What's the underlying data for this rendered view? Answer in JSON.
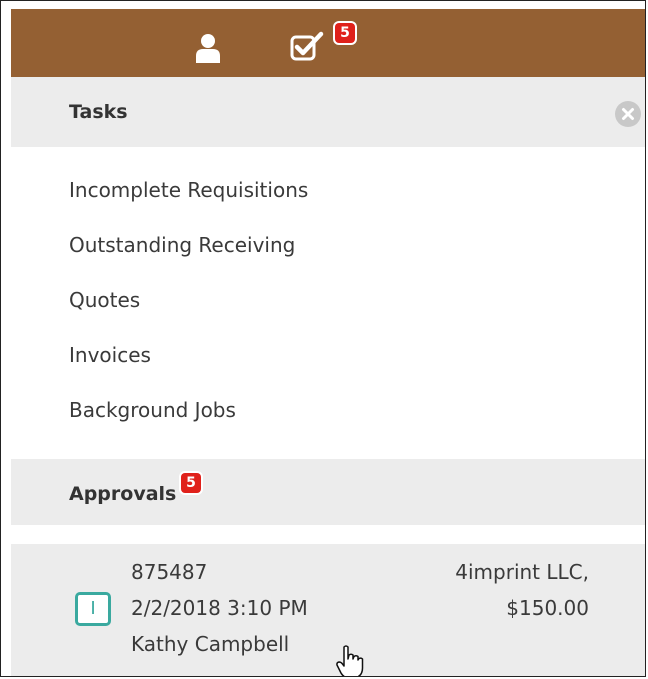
{
  "header": {
    "user_icon": "user-icon",
    "tasks_icon": "checkbox-check-icon",
    "tasks_badge": "5"
  },
  "tasks": {
    "title": "Tasks",
    "close_icon": "close-circle-icon",
    "items": [
      "Incomplete Requisitions",
      "Outstanding Receiving",
      "Quotes",
      "Invoices",
      "Background Jobs"
    ]
  },
  "approvals": {
    "title": "Approvals",
    "badge": "5",
    "items": [
      {
        "id": "875487",
        "datetime": "2/2/2018 3:10 PM",
        "requester": "Kathy Campbell",
        "supplier": "4imprint LLC,",
        "amount": "$150.00",
        "status_letter": "I",
        "status_color": "#3aa99f"
      }
    ]
  },
  "colors": {
    "topbar": "#946033",
    "badge": "#e0211b",
    "section_bg": "#ececec"
  }
}
